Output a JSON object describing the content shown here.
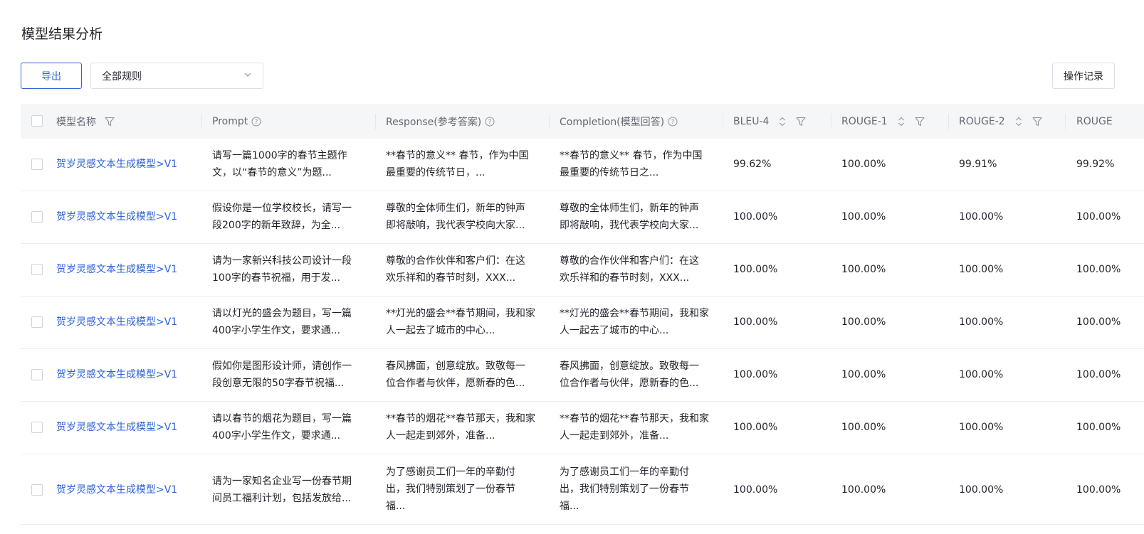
{
  "page": {
    "title": "模型结果分析"
  },
  "toolbar": {
    "export_label": "导出",
    "rule_select": "全部规则",
    "log_label": "操作记录"
  },
  "table": {
    "columns": [
      "模型名称",
      "Prompt",
      "Response(参考答案)",
      "Completion(模型回答)",
      "BLEU-4",
      "ROUGE-1",
      "ROUGE-2",
      "ROUGE"
    ],
    "rows": [
      {
        "model": "贺岁灵感文本生成模型>V1",
        "prompt": [
          "请写一篇1000字的春节主题作",
          "文，以“春节的意义”为题..."
        ],
        "response": [
          "**春节的意义** 春节，作为中国",
          "最重要的传统节日，..."
        ],
        "completion": [
          "**春节的意义** 春节，作为中国",
          "最重要的传统节日之..."
        ],
        "bleu4": "99.62%",
        "rouge1": "100.00%",
        "rouge2": "99.91%",
        "rougeL": "99.92%"
      },
      {
        "model": "贺岁灵感文本生成模型>V1",
        "prompt": [
          "假设你是一位学校校长，请写一",
          "段200字的新年致辞，为全..."
        ],
        "response": [
          "尊敬的全体师生们，新年的钟声",
          "即将敲响，我代表学校向大家..."
        ],
        "completion": [
          "尊敬的全体师生们，新年的钟声",
          "即将敲响，我代表学校向大家..."
        ],
        "bleu4": "100.00%",
        "rouge1": "100.00%",
        "rouge2": "100.00%",
        "rougeL": "100.00%"
      },
      {
        "model": "贺岁灵感文本生成模型>V1",
        "prompt": [
          "请为一家新兴科技公司设计一段",
          "100字的春节祝福，用于发..."
        ],
        "response": [
          "尊敬的合作伙伴和客户们：在这",
          "欢乐祥和的春节时刻，XXX..."
        ],
        "completion": [
          "尊敬的合作伙伴和客户们：在这",
          "欢乐祥和的春节时刻，XXX..."
        ],
        "bleu4": "100.00%",
        "rouge1": "100.00%",
        "rouge2": "100.00%",
        "rougeL": "100.00%"
      },
      {
        "model": "贺岁灵感文本生成模型>V1",
        "prompt": [
          "请以灯光的盛会为题目，写一篇",
          "400字小学生作文，要求通..."
        ],
        "response": [
          "**灯光的盛会**春节期间，我和家",
          "人一起去了城市的中心..."
        ],
        "completion": [
          "**灯光的盛会**春节期间，我和家",
          "人一起去了城市的中心..."
        ],
        "bleu4": "100.00%",
        "rouge1": "100.00%",
        "rouge2": "100.00%",
        "rougeL": "100.00%"
      },
      {
        "model": "贺岁灵感文本生成模型>V1",
        "prompt": [
          "假如你是图形设计师，请创作一",
          "段创意无限的50字春节祝福..."
        ],
        "response": [
          "春风拂面，创意绽放。致敬每一",
          "位合作者与伙伴，愿新春的色..."
        ],
        "completion": [
          "春风拂面，创意绽放。致敬每一",
          "位合作者与伙伴，愿新春的色..."
        ],
        "bleu4": "100.00%",
        "rouge1": "100.00%",
        "rouge2": "100.00%",
        "rougeL": "100.00%"
      },
      {
        "model": "贺岁灵感文本生成模型>V1",
        "prompt": [
          "请以春节的烟花为题目，写一篇",
          "400字小学生作文，要求通..."
        ],
        "response": [
          "**春节的烟花**春节那天，我和家",
          "人一起走到郊外，准备..."
        ],
        "completion": [
          "**春节的烟花**春节那天，我和家",
          "人一起走到郊外，准备..."
        ],
        "bleu4": "100.00%",
        "rouge1": "100.00%",
        "rouge2": "100.00%",
        "rougeL": "100.00%"
      },
      {
        "model": "贺岁灵感文本生成模型>V1",
        "prompt": [
          "请为一家知名企业写一份春节期",
          "间员工福利计划，包括发放给..."
        ],
        "response": [
          "为了感谢员工们一年的辛勤付",
          "出，我们特别策划了一份春节",
          "福..."
        ],
        "completion": [
          "为了感谢员工们一年的辛勤付",
          "出，我们特别策划了一份春节",
          "福..."
        ],
        "bleu4": "100.00%",
        "rouge1": "100.00%",
        "rouge2": "100.00%",
        "rougeL": "100.00%"
      }
    ]
  }
}
